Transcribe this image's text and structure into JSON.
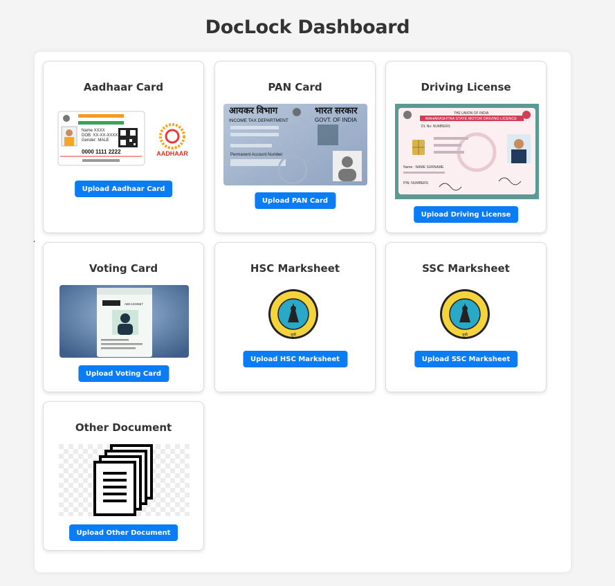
{
  "page": {
    "title": "DocLock Dashboard"
  },
  "cards": [
    {
      "title": "Aadhaar Card",
      "button": "Upload Aadhaar Card",
      "image": {
        "id_lines": [
          "Name XXXX",
          "DOB: XX-XX-XXXX",
          "Gender: MALE"
        ],
        "number": "0000 1111 2222",
        "logo_text": "AADHAAR"
      }
    },
    {
      "title": "PAN Card",
      "button": "Upload PAN Card",
      "image": {
        "left_hindi": "आयकर विभाग",
        "right_hindi": "भारत सरकार",
        "dept": "INCOME TAX DEPARTMENT",
        "govt": "GOVT. OF INDIA",
        "pan_label": "Permanent Account Number"
      }
    },
    {
      "title": "Driving License",
      "button": "Upload Driving License",
      "image": {
        "union": "THE UNION OF INDIA",
        "state": "MAHARASHTRA STATE MOTOR DRIVING LICENCE",
        "dl_no": "DL No: NUMBERS",
        "name": "Name : NAME SURNAME",
        "pin": "PIN: NUMBERS"
      }
    },
    {
      "title": "Voting Card",
      "button": "Upload Voting Card",
      "image": {
        "epic": "ABC1234567"
      }
    },
    {
      "title": "HSC Marksheet",
      "button": "Upload HSC Marksheet",
      "image": {
        "seal": "पुणे"
      }
    },
    {
      "title": "SSC Marksheet",
      "button": "Upload SSC Marksheet",
      "image": {
        "seal": "पुणे"
      }
    },
    {
      "title": "Other Document",
      "button": "Upload Other Document",
      "image": {}
    }
  ],
  "colors": {
    "accent": "#0a7cf5",
    "title": "#333333"
  },
  "icons": [
    "aadhaar-card-image",
    "pan-card-image",
    "driving-license-image",
    "voter-card-image",
    "board-seal-image",
    "board-seal-image",
    "documents-stack-icon"
  ]
}
